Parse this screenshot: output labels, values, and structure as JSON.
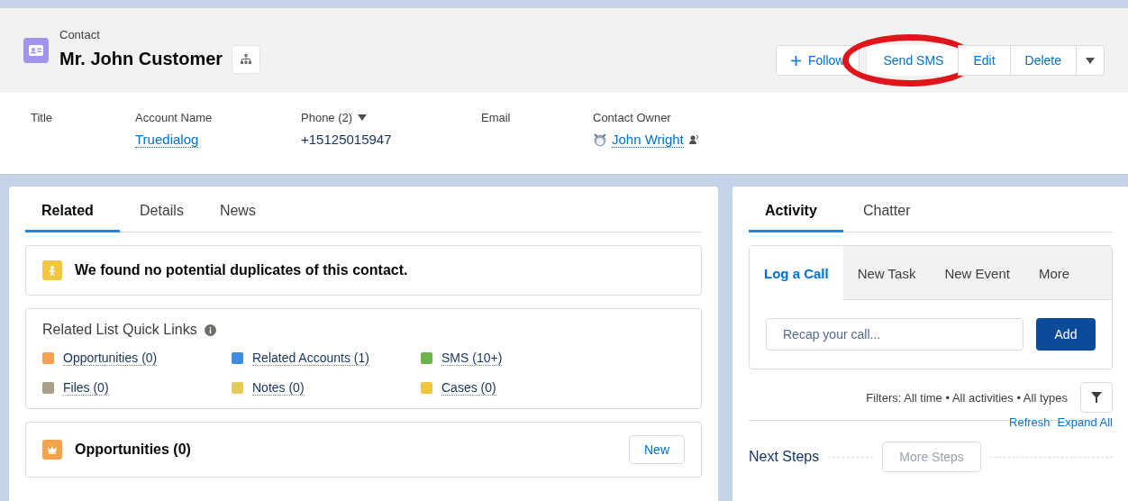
{
  "header": {
    "object_type": "Contact",
    "name": "Mr. John Customer",
    "actions": [
      {
        "label": "Follow",
        "kind": "follow",
        "circled": false
      },
      {
        "label": "Send SMS",
        "kind": "group",
        "circled": true
      },
      {
        "label": "Edit",
        "kind": "group",
        "circled": false
      },
      {
        "label": "Delete",
        "kind": "group",
        "circled": false
      },
      {
        "kind": "menu",
        "circled": false
      }
    ]
  },
  "fields": [
    {
      "label": "Title",
      "kind": "text"
    },
    {
      "label": "Account Name",
      "value": "Truedialog",
      "kind": "link"
    },
    {
      "label": "Phone (2)",
      "value": "+15125015947",
      "kind": "phone"
    },
    {
      "label": "Email",
      "kind": "text"
    },
    {
      "label": "Contact Owner",
      "value": "John Wright",
      "kind": "owner"
    }
  ],
  "left_tabs": [
    {
      "label": "Related",
      "selected": true
    },
    {
      "label": "Details",
      "selected": false
    },
    {
      "label": "News",
      "selected": false
    }
  ],
  "duplicates_message": "We found no potential duplicates of this contact.",
  "quick_links": {
    "title": "Related List Quick Links",
    "items": [
      {
        "label": "Opportunities (0)",
        "color": "#f4a24b"
      },
      {
        "label": "Related Accounts (1)",
        "color": "#3e8de0"
      },
      {
        "label": "SMS (10+)",
        "color": "#6bb54a"
      },
      {
        "label": "Files (0)",
        "color": "#a89f8a"
      },
      {
        "label": "Notes (0)",
        "color": "#e6ca58"
      },
      {
        "label": "Cases (0)",
        "color": "#f2c63e"
      }
    ]
  },
  "opportunities": {
    "title": "Opportunities (0)",
    "button": "New"
  },
  "right_tabs": [
    {
      "label": "Activity",
      "selected": true
    },
    {
      "label": "Chatter",
      "selected": false
    }
  ],
  "composer": {
    "tabs": [
      {
        "label": "Log a Call",
        "selected": true
      },
      {
        "label": "New Task",
        "selected": false
      },
      {
        "label": "New Event",
        "selected": false
      },
      {
        "label": "More",
        "selected": false
      }
    ],
    "placeholder": "Recap your call...",
    "button": "Add"
  },
  "filters": "Filters: All time • All activities • All types",
  "links": [
    "Refresh",
    "Expand All"
  ],
  "next_steps": {
    "title": "Next Steps",
    "button": "More Steps",
    "disabled": true
  }
}
